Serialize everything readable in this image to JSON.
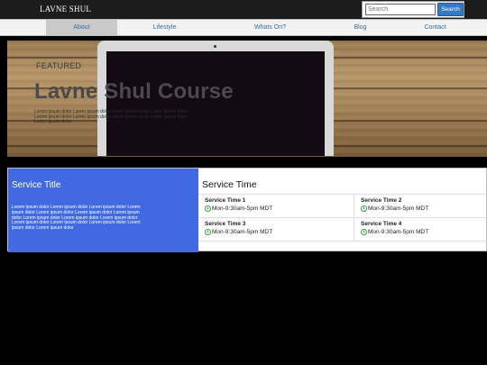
{
  "header": {
    "brand": "LAVNE SHUL"
  },
  "search": {
    "placeholder": "Search",
    "button": "Search"
  },
  "nav": {
    "items": [
      {
        "label": "About",
        "active": true
      },
      {
        "label": "Lifestyle"
      },
      {
        "label": "Whats On?"
      },
      {
        "label": "Blog"
      },
      {
        "label": "Contact"
      }
    ]
  },
  "hero": {
    "eyebrow": "FEATURED",
    "title": "Lavne Shul Course",
    "description": "Lorem ipsum dolor Lorem ipsum dolor Lorem ipsum dolor Lorem ipsum dolor Lorem ipsum dolor Lorem ipsum dolor Lorem ipsum dolor Lorem ipsum dolor Lorem ipsum dolor"
  },
  "service_intro": {
    "title": "Service Title",
    "description": "Lorem ipsum dolor Lorem ipsum dolor Lorem ipsum dolor Lorem ipsum dolor Lorem ipsum dolor Lorem ipsum dolor Lorem ipsum dolor Lorem ipsum dolor Lorem ipsum dolor Lorem ipsum dolor Lorem ipsum dolor Lorem ipsum dolor Lorem ipsum dolor Lorem ipsum dolor Lorem ipsum dolor"
  },
  "service_time": {
    "title": "Service Time",
    "items": [
      {
        "name": "Service Time 1",
        "time": "Mon-9:30am-5pm MDT"
      },
      {
        "name": "Service Time 2",
        "time": "Mon-9:30am-5pm MDT"
      },
      {
        "name": "Service Time 3",
        "time": "Mon-9:30am-5pm MDT"
      },
      {
        "name": "Service Time 4",
        "time": "Mon-9:30am-5pm MDT"
      }
    ]
  },
  "colors": {
    "accent": "#4169e1",
    "search_button": "#3579c4",
    "clock_icon": "#2e9e3a"
  },
  "icons": {
    "time": "clock-icon"
  }
}
